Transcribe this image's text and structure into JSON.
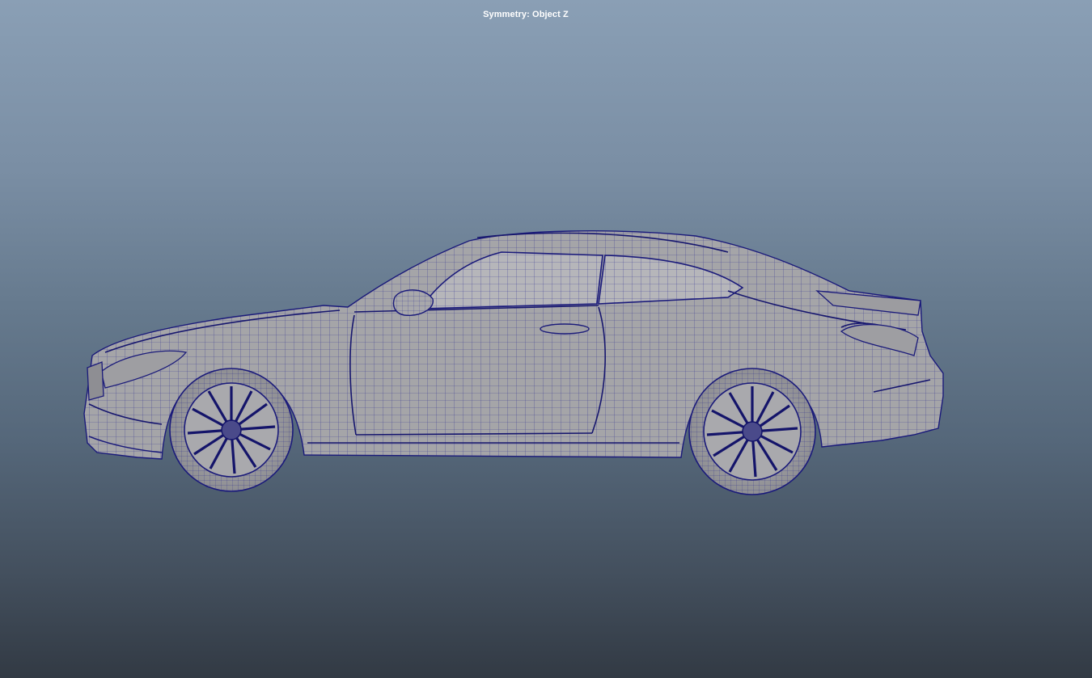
{
  "viewport": {
    "symmetry_label": "Symmetry: Object Z"
  },
  "model": {
    "object": "car-coupe",
    "display_mode": "wireframe-on-shaded",
    "view": "side",
    "colors": {
      "shaded_fill": "#a3a3a6",
      "wire_color": "#1e1e8c",
      "window_fill": "#b4b4b8",
      "tire_fill": "#9b9b9e"
    }
  }
}
